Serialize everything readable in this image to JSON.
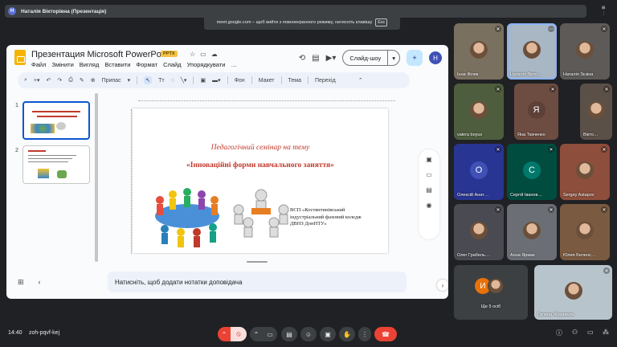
{
  "meet": {
    "presenter_label": "Наталія Вікторівна (Презентація)",
    "presenter_initial": "Н",
    "fullscreen_notice": "meet.google.com – щоб вийти з повноекранного режиму, натисніть клавішу",
    "esc_key": "Esc",
    "time": "14:40",
    "meeting_code": "zoh-pqvf-kej"
  },
  "slides_app": {
    "title": "Презентация Microsoft PowerPoint",
    "badge": "PPTX",
    "menus": [
      "Файл",
      "Змінити",
      "Вигляд",
      "Вставити",
      "Формат",
      "Слайд",
      "Упорядкувати",
      "…"
    ],
    "slideshow_label": "Слайд-шоу",
    "user_initial": "H",
    "toolbar": {
      "fit_label": "Припас",
      "background": "Фон",
      "layout": "Макет",
      "theme": "Тема",
      "transition": "Перехід"
    },
    "slide_numbers": [
      "1",
      "2"
    ],
    "notes_placeholder": "Натисніть, щоб додати нотатки доповідача"
  },
  "slide": {
    "subtitle": "Педагогічний семінар на тему",
    "title": "«Інноваційні форми навчального заняття»",
    "college": "ВСП «Костянтинівський індустріальний фаховий коледж ДВНЗ ДонНТУ»"
  },
  "participants": [
    {
      "name": "Інна Філик",
      "type": "photo"
    },
    {
      "name": "Наталія Вікто…",
      "type": "photo"
    },
    {
      "name": "Наталія Зєзіна",
      "type": "photo"
    },
    {
      "name": "valera boyus",
      "type": "photo"
    },
    {
      "name": "Яна Ткаченко",
      "type": "initial",
      "initial": "Я",
      "color": "#5d4037"
    },
    {
      "name": "Вікто…",
      "type": "photo"
    },
    {
      "name": "Олексій Анат…",
      "type": "initial",
      "initial": "О",
      "color": "#3f51b5"
    },
    {
      "name": "Сергій Іванов…",
      "type": "initial",
      "initial": "С",
      "color": "#00796b"
    },
    {
      "name": "Sergey Astapov",
      "type": "photo"
    },
    {
      "name": "Олег Грабель…",
      "type": "photo"
    },
    {
      "name": "Анна Ярмак",
      "type": "photo"
    },
    {
      "name": "Юлия Беленс…",
      "type": "photo"
    },
    {
      "name": "Ще 5 осіб",
      "type": "more",
      "initial": "И",
      "color": "#e8710a"
    },
    {
      "name": "Галина Журавель",
      "type": "photo"
    }
  ],
  "colors": {
    "accent": "#8ab4f8",
    "end_call": "#ea4335",
    "slide_red": "#c0392b"
  }
}
